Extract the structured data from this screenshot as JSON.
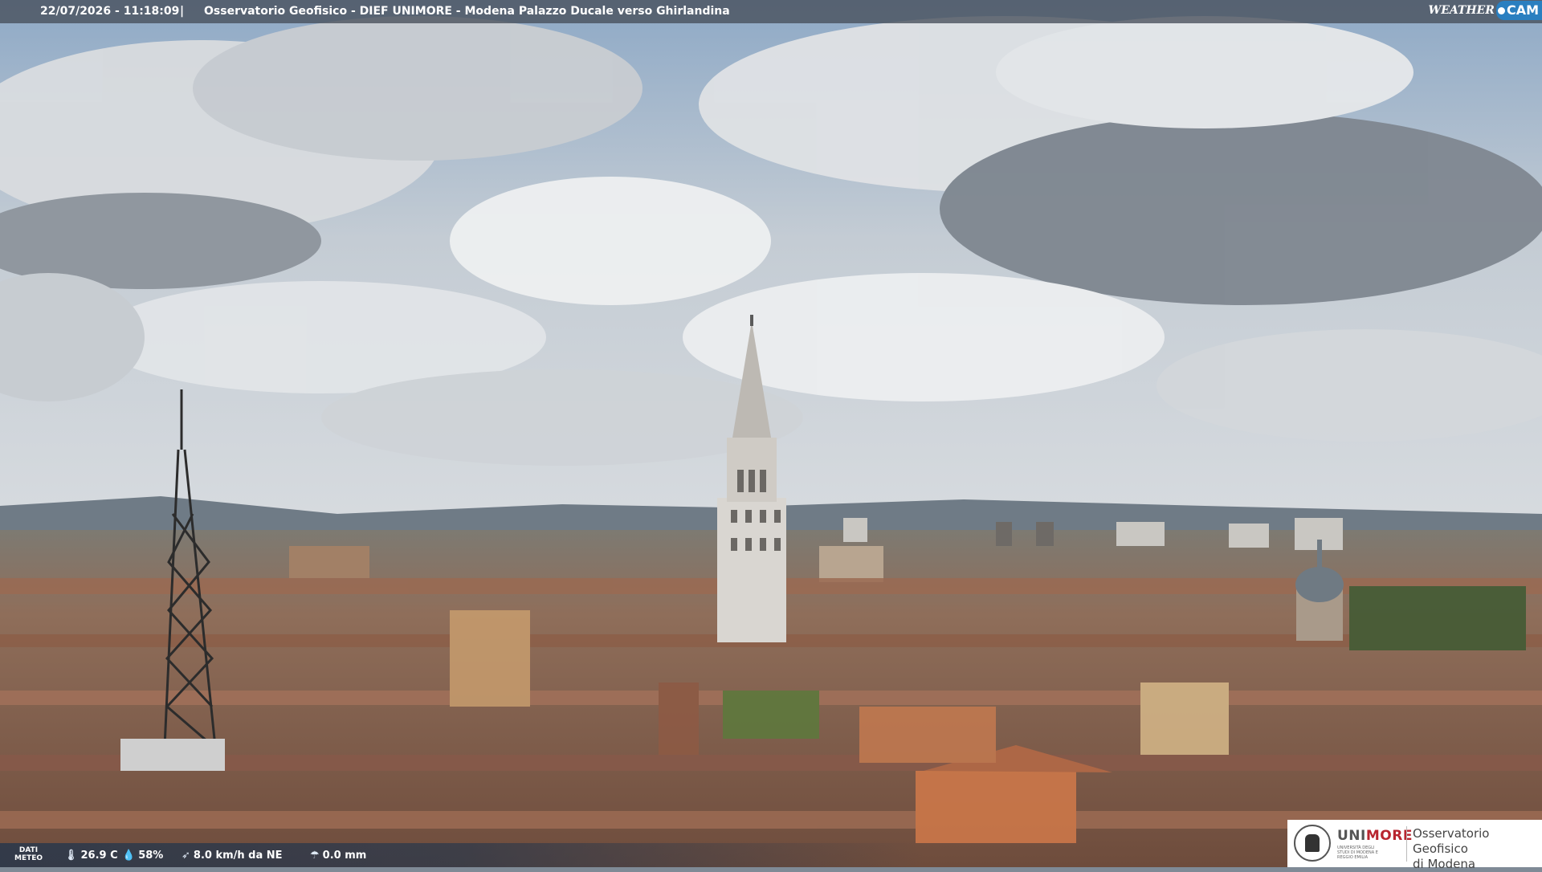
{
  "overlay": {
    "timestamp": "22/07/2026 - 11:18:09",
    "separator": "|",
    "title": "Osservatorio Geofisico - DIEF UNIMORE - Modena Palazzo Ducale verso Ghirlandina",
    "brand_word": "WEATHER",
    "brand_cam": "CAM"
  },
  "meteo": {
    "label_line1": "DATI",
    "label_line2": "METEO",
    "temperature": "26.9 C",
    "humidity": "58%",
    "wind": "8.0 km/h da NE",
    "rain": "0.0 mm",
    "icons": [
      "thermometer-icon",
      "droplet-icon",
      "wind-icon",
      "rain-icon"
    ]
  },
  "logo": {
    "uni_part1": "UNI",
    "uni_part2": "MORE",
    "uni_sub": "UNIVERSITÀ DEGLI STUDI DI MODENA E REGGIO EMILIA",
    "obs_line1": "Osservatorio Geofisico",
    "obs_line2": "di Modena"
  },
  "colors": {
    "sky": "#b9c4cf",
    "cloud": "#e9ecef",
    "roof": "#9a6a52",
    "tower": "#d9d6d1",
    "brand_blue": "#2a7fc0",
    "unimore_red": "#b8252f"
  }
}
